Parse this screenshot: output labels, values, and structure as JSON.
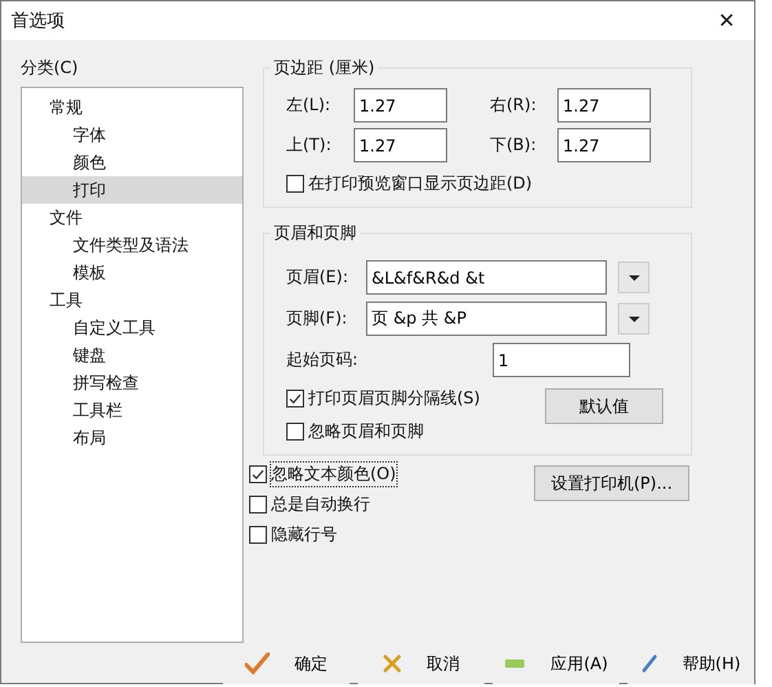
{
  "window": {
    "title": "首选项",
    "close": "✕"
  },
  "category": {
    "label": "分类(C)",
    "tree": [
      {
        "label": "常规",
        "selected": false,
        "children": [
          {
            "label": "字体",
            "selected": false
          },
          {
            "label": "颜色",
            "selected": false
          },
          {
            "label": "打印",
            "selected": true
          }
        ]
      },
      {
        "label": "文件",
        "selected": false,
        "children": [
          {
            "label": "文件类型及语法",
            "selected": false
          },
          {
            "label": "模板",
            "selected": false
          }
        ]
      },
      {
        "label": "工具",
        "selected": false,
        "children": [
          {
            "label": "自定义工具",
            "selected": false
          },
          {
            "label": "键盘",
            "selected": false
          },
          {
            "label": "拼写检查",
            "selected": false
          },
          {
            "label": "工具栏",
            "selected": false
          },
          {
            "label": "布局",
            "selected": false
          }
        ]
      }
    ]
  },
  "margins": {
    "title": "页边距 (厘米)",
    "fields": [
      {
        "label": "左(L):",
        "value": "1.27"
      },
      {
        "label": "右(R):",
        "value": "1.27"
      },
      {
        "label": "上(T):",
        "value": "1.27"
      },
      {
        "label": "下(B):",
        "value": "1.27"
      }
    ],
    "show_in_preview": {
      "label": "在打印预览窗口显示页边距(D)",
      "checked": false
    }
  },
  "header_footer": {
    "title": "页眉和页脚",
    "header": {
      "label": "页眉(E):",
      "value": "&L&f&R&d &t"
    },
    "footer": {
      "label": "页脚(F):",
      "value": "页 &p 共 &P"
    },
    "start_page": {
      "label": "起始页码:",
      "value": "1"
    },
    "checkboxes": [
      {
        "label": "打印页眉页脚分隔线(S)",
        "checked": true
      },
      {
        "label": "忽略页眉和页脚",
        "checked": false
      }
    ],
    "default_button": "默认值"
  },
  "options": [
    {
      "label": "忽略文本颜色(O)",
      "checked": true,
      "focused": true
    },
    {
      "label": "总是自动换行",
      "checked": false,
      "focused": false
    },
    {
      "label": "隐藏行号",
      "checked": false,
      "focused": false
    }
  ],
  "printer_button": "设置打印机(P)...",
  "buttons": [
    {
      "label": "确定",
      "kind": "ok"
    },
    {
      "label": "取消",
      "kind": "cancel"
    },
    {
      "label": "应用(A)",
      "kind": "apply"
    },
    {
      "label": "帮助(H)",
      "kind": "help"
    }
  ]
}
